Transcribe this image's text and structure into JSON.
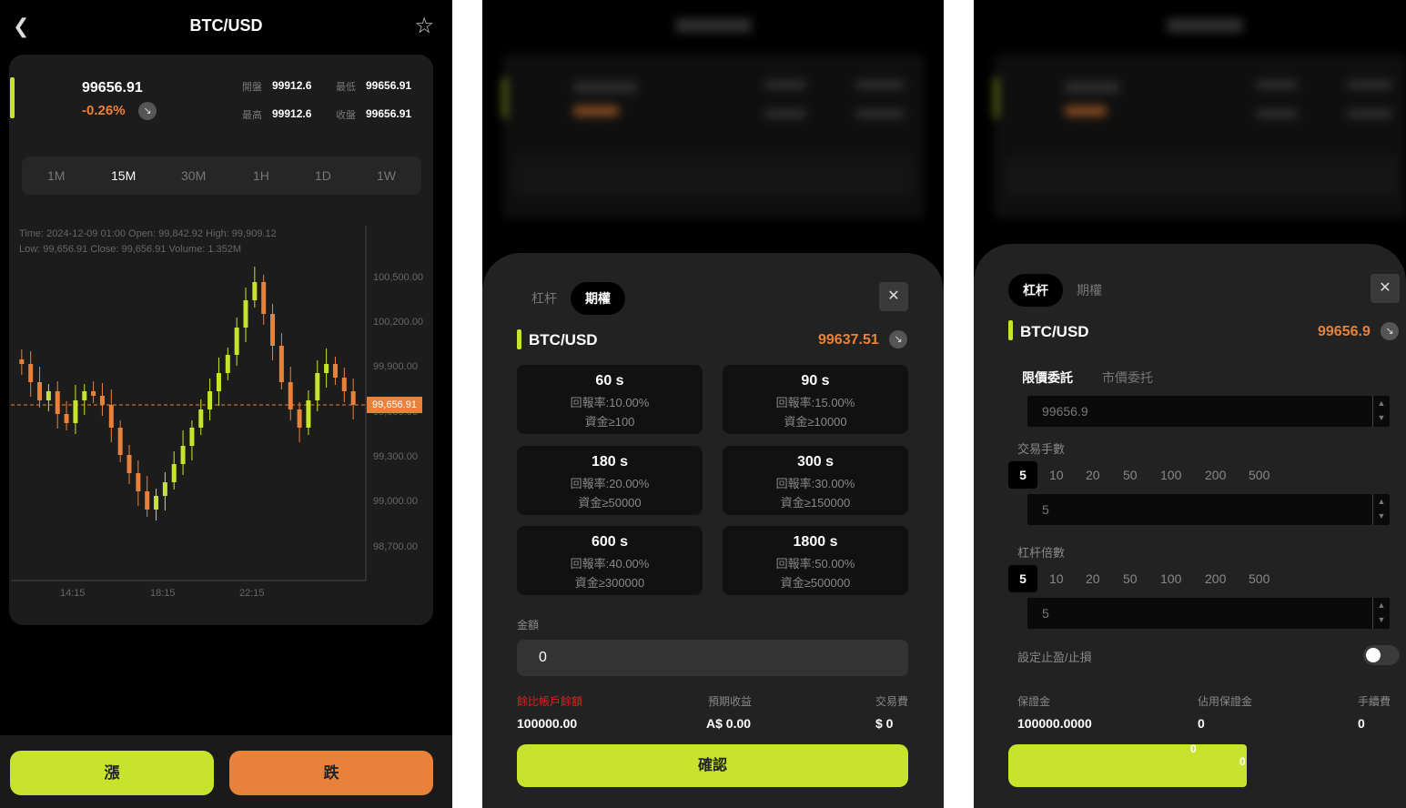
{
  "screen1": {
    "title": "BTC/USD",
    "price": "99656.91",
    "change": "-0.26%",
    "stats": [
      {
        "label": "開盤",
        "value": "99912.6"
      },
      {
        "label": "最低",
        "value": "99656.91"
      },
      {
        "label": "最高",
        "value": "99912.6"
      },
      {
        "label": "收盤",
        "value": "99656.91"
      }
    ],
    "intervals": [
      "1M",
      "15M",
      "30M",
      "1H",
      "1D",
      "1W"
    ],
    "active_interval": "15M",
    "chart_info_line1": "Time: 2024-12-09 01:00    Open: 99,842.92    High: 99,909.12",
    "chart_info_line2": "Low: 99,656.91    Close: 99,656.91    Volume: 1.352M",
    "y_axis": [
      "100,500.00",
      "100,200.00",
      "99,900.00",
      "99,600.00",
      "99,300.00",
      "99,000.00",
      "98,700.00"
    ],
    "x_axis": [
      "14:15",
      "18:15",
      "22:15"
    ],
    "price_tag": "99,656.91",
    "btn_up": "漲",
    "btn_down": "跌",
    "colors": {
      "accent": "#c8e32d",
      "down": "#e8823a"
    }
  },
  "screen2": {
    "tabs": [
      "杠杆",
      "期權"
    ],
    "active_tab": "期權",
    "pair": "BTC/USD",
    "price": "99637.51",
    "options": [
      {
        "duration": "60 s",
        "rate": "回報率:10.00%",
        "min": "資金≥100"
      },
      {
        "duration": "90 s",
        "rate": "回報率:15.00%",
        "min": "資金≥10000"
      },
      {
        "duration": "180 s",
        "rate": "回報率:20.00%",
        "min": "資金≥50000"
      },
      {
        "duration": "300 s",
        "rate": "回報率:30.00%",
        "min": "資金≥150000"
      },
      {
        "duration": "600 s",
        "rate": "回報率:40.00%",
        "min": "資金≥300000"
      },
      {
        "duration": "1800 s",
        "rate": "回報率:50.00%",
        "min": "資金≥500000"
      }
    ],
    "amount_label": "金額",
    "amount_value": "0",
    "balance_label": "餘比帳戶餘額",
    "balance_value": "100000.00",
    "profit_label": "預期收益",
    "profit_value": "A$ 0.00",
    "fee_label": "交易費",
    "fee_value": "$ 0",
    "confirm": "確認"
  },
  "screen3": {
    "tabs": [
      "杠杆",
      "期權"
    ],
    "active_tab": "杠杆",
    "pair": "BTC/USD",
    "price": "99656.9",
    "order_types": [
      "限價委託",
      "市價委托"
    ],
    "limit_price": "99656.9",
    "lots_label": "交易手數",
    "chips": [
      "5",
      "10",
      "20",
      "50",
      "100",
      "200",
      "500"
    ],
    "lots_value": "5",
    "leverage_label": "杠杆倍數",
    "leverage_value": "5",
    "stop_label": "設定止盈/止損",
    "margin_label": "保證金",
    "margin_value": "100000.0000",
    "used_label": "佔用保證金",
    "used_value": "0",
    "fee_label": "手續費",
    "fee_value": "0",
    "submit_fragments": [
      "0",
      "0"
    ]
  }
}
